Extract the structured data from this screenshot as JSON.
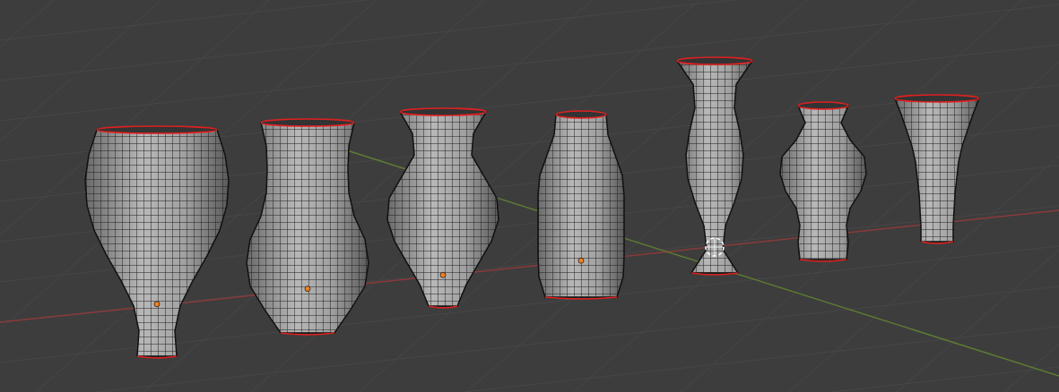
{
  "viewport": {
    "objects": [
      {
        "kind": "ovoid",
        "origin": true
      },
      {
        "kind": "bulb-neck",
        "origin": true
      },
      {
        "kind": "baluster",
        "origin": true
      },
      {
        "kind": "bottle",
        "origin": true
      },
      {
        "kind": "tall-baluster",
        "origin": false
      },
      {
        "kind": "urn",
        "origin": false
      },
      {
        "kind": "flared",
        "origin": false
      }
    ]
  }
}
